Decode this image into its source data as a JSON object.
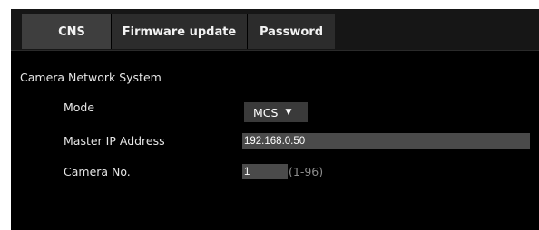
{
  "tabs": [
    {
      "label": "CNS",
      "active": true
    },
    {
      "label": "Firmware update",
      "active": false
    },
    {
      "label": "Password",
      "active": false
    }
  ],
  "section": {
    "title": "Camera Network System"
  },
  "fields": {
    "mode": {
      "label": "Mode",
      "value": "MCS",
      "arrow_icon": "triangle-down"
    },
    "master_ip": {
      "label": "Master IP Address",
      "value": "192.168.0.50"
    },
    "camera_no": {
      "label": "Camera No.",
      "value": "1",
      "range": "(1-96)"
    }
  },
  "colors": {
    "background": "#000000",
    "tab_active": "#3e3e3e",
    "tab": "#2c2c2c",
    "input": "#4a4a4a",
    "hint": "#8c8c8c"
  }
}
